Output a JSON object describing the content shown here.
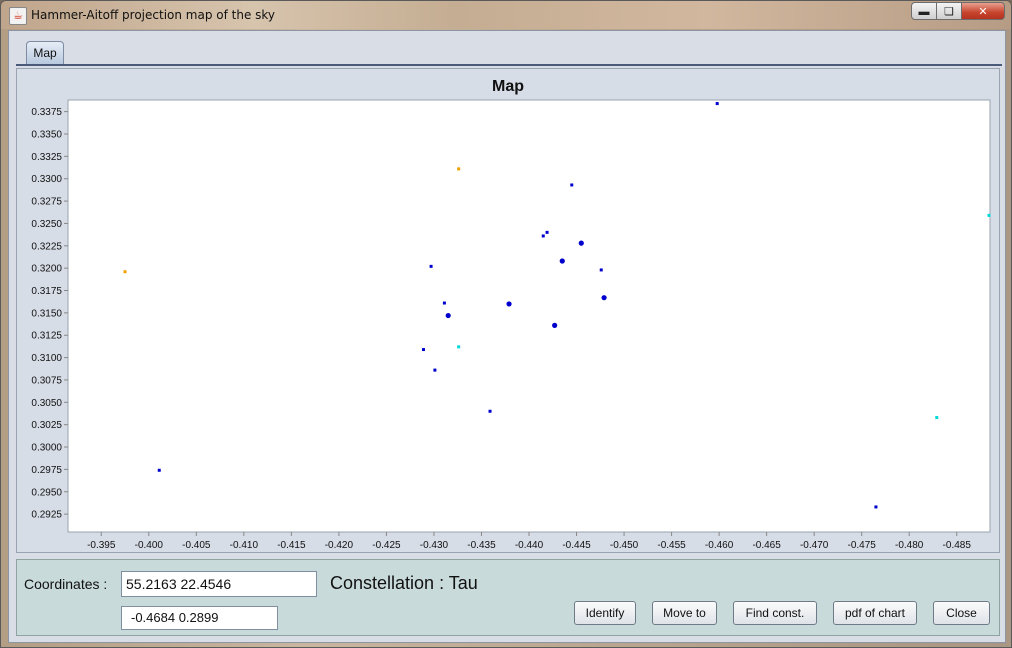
{
  "window": {
    "title": "Hammer-Aitoff projection map of the sky",
    "app_icon": "java-icon",
    "controls": [
      "minimize-icon",
      "maximize-icon",
      "close-icon"
    ]
  },
  "tabs": [
    {
      "label": "Map",
      "selected": true
    }
  ],
  "chart_data": {
    "type": "scatter",
    "title": "Map",
    "xlabel": "",
    "ylabel": "",
    "xlim": [
      -0.3915,
      -0.4885
    ],
    "ylim": [
      0.2905,
      0.3388
    ],
    "x_ticks": [
      "-0.395",
      "-0.400",
      "-0.405",
      "-0.410",
      "-0.415",
      "-0.420",
      "-0.425",
      "-0.430",
      "-0.435",
      "-0.440",
      "-0.445",
      "-0.450",
      "-0.455",
      "-0.460",
      "-0.465",
      "-0.470",
      "-0.475",
      "-0.480",
      "-0.485"
    ],
    "y_ticks": [
      "0.2925",
      "0.2950",
      "0.2975",
      "0.3000",
      "0.3025",
      "0.3050",
      "0.3075",
      "0.3100",
      "0.3125",
      "0.3150",
      "0.3175",
      "0.3200",
      "0.3225",
      "0.3250",
      "0.3275",
      "0.3300",
      "0.3325",
      "0.3350",
      "0.3375"
    ],
    "grid": false,
    "colors": {
      "blue": "#0000cc",
      "orange": "#f0a000",
      "cyan": "#00d8d8"
    },
    "points": [
      {
        "x": -0.4598,
        "y": 0.3384,
        "color": "blue",
        "size": "small"
      },
      {
        "x": -0.4326,
        "y": 0.3311,
        "color": "orange",
        "size": "small"
      },
      {
        "x": -0.4445,
        "y": 0.3293,
        "color": "blue",
        "size": "small"
      },
      {
        "x": -0.4885,
        "y": 0.3259,
        "color": "cyan",
        "size": "small"
      },
      {
        "x": -0.4419,
        "y": 0.324,
        "color": "blue",
        "size": "small"
      },
      {
        "x": -0.4415,
        "y": 0.3236,
        "color": "blue",
        "size": "small"
      },
      {
        "x": -0.4455,
        "y": 0.3228,
        "color": "blue",
        "size": "large"
      },
      {
        "x": -0.4435,
        "y": 0.3208,
        "color": "blue",
        "size": "large"
      },
      {
        "x": -0.3975,
        "y": 0.3196,
        "color": "orange",
        "size": "small"
      },
      {
        "x": -0.4297,
        "y": 0.3202,
        "color": "blue",
        "size": "small"
      },
      {
        "x": -0.4476,
        "y": 0.3198,
        "color": "blue",
        "size": "small"
      },
      {
        "x": -0.4479,
        "y": 0.3167,
        "color": "blue",
        "size": "large"
      },
      {
        "x": -0.4311,
        "y": 0.3161,
        "color": "blue",
        "size": "small"
      },
      {
        "x": -0.4379,
        "y": 0.316,
        "color": "blue",
        "size": "large"
      },
      {
        "x": -0.4315,
        "y": 0.3147,
        "color": "blue",
        "size": "large"
      },
      {
        "x": -0.4427,
        "y": 0.3136,
        "color": "blue",
        "size": "large"
      },
      {
        "x": -0.4326,
        "y": 0.3112,
        "color": "cyan",
        "size": "small"
      },
      {
        "x": -0.4289,
        "y": 0.3109,
        "color": "blue",
        "size": "small"
      },
      {
        "x": -0.4301,
        "y": 0.3086,
        "color": "blue",
        "size": "small"
      },
      {
        "x": -0.4359,
        "y": 0.304,
        "color": "blue",
        "size": "small"
      },
      {
        "x": -0.4829,
        "y": 0.3033,
        "color": "cyan",
        "size": "small"
      },
      {
        "x": -0.4011,
        "y": 0.2974,
        "color": "blue",
        "size": "small"
      },
      {
        "x": -0.4765,
        "y": 0.2933,
        "color": "blue",
        "size": "small"
      }
    ]
  },
  "bottom": {
    "coordinates_label": "Coordinates :",
    "coordinates_value": "55.2163  22.4546",
    "projected_value": "-0.4684    0.2899",
    "constellation_text": "Constellation : Tau",
    "buttons": {
      "identify": "Identify",
      "move_to": "Move to",
      "find_const": "Find const.",
      "pdf_of_chart": "pdf of chart",
      "close": "Close"
    }
  }
}
